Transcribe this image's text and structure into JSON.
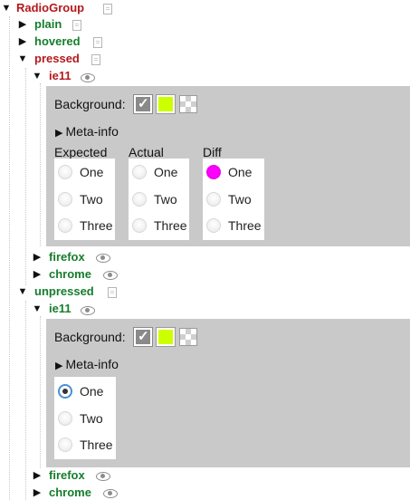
{
  "tree": {
    "root": {
      "label": "RadioGroup"
    },
    "plain": {
      "label": "plain"
    },
    "hovered": {
      "label": "hovered"
    },
    "pressed": {
      "label": "pressed",
      "ie11": {
        "label": "ie11"
      },
      "firefox": {
        "label": "firefox"
      },
      "chrome": {
        "label": "chrome"
      }
    },
    "unpressed": {
      "label": "unpressed",
      "ie11": {
        "label": "ie11"
      },
      "firefox": {
        "label": "firefox"
      },
      "chrome": {
        "label": "chrome"
      }
    }
  },
  "panel": {
    "background_label": "Background:",
    "meta_info_label": "Meta-info",
    "columns": {
      "expected": "Expected",
      "actual": "Actual",
      "diff": "Diff"
    },
    "options": [
      "One",
      "Two",
      "Three"
    ]
  },
  "colors": {
    "red": "#b5181c",
    "green": "#157d2c",
    "panel": "#c9c9c9",
    "lime": "#ccff00",
    "diff": "#ff00ff"
  },
  "icons": {
    "arrow": "triangle",
    "copy": "copy-icon",
    "eye": "eye-icon"
  }
}
